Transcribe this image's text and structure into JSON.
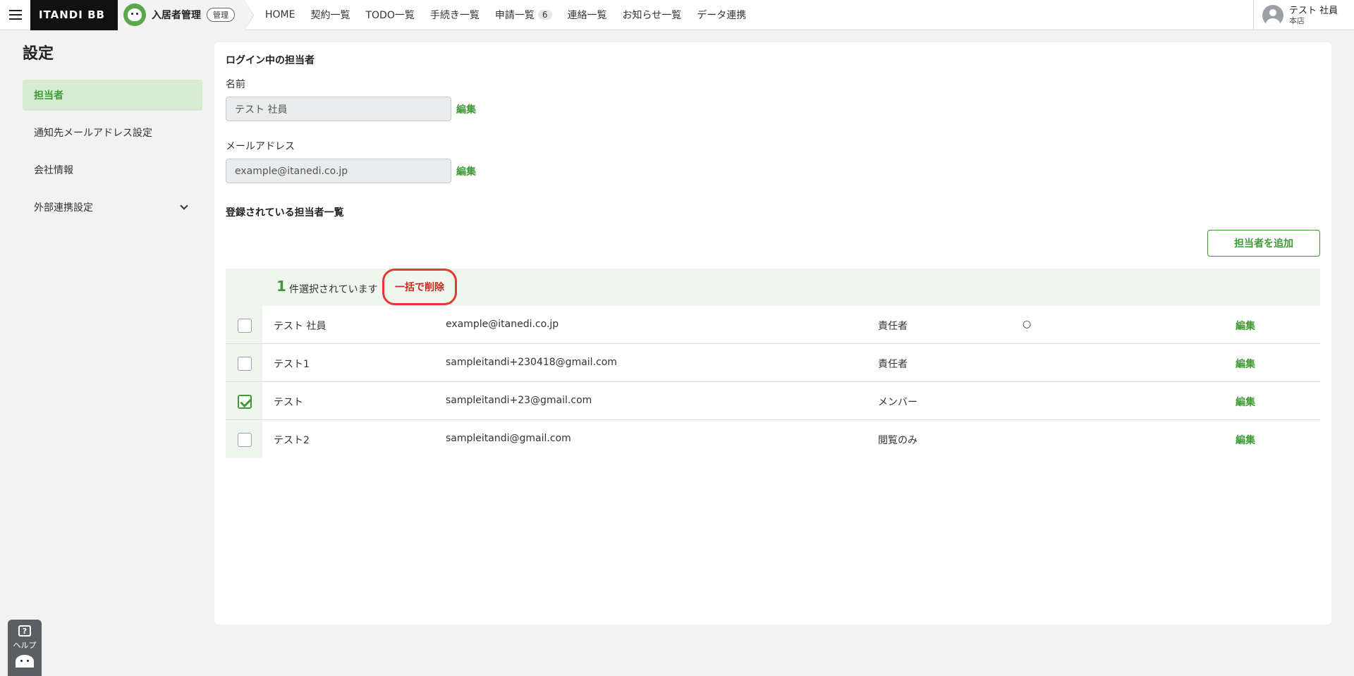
{
  "header": {
    "brand": "ITANDI BB",
    "app_title": "入居者管理",
    "admin_badge": "管理",
    "nav": [
      {
        "label": "HOME"
      },
      {
        "label": "契約一覧"
      },
      {
        "label": "TODO一覧"
      },
      {
        "label": "手続き一覧"
      },
      {
        "label": "申請一覧",
        "count": "6"
      },
      {
        "label": "連絡一覧"
      },
      {
        "label": "お知らせ一覧"
      },
      {
        "label": "データ連携"
      }
    ],
    "user": {
      "name": "テスト 社員",
      "branch": "本店"
    }
  },
  "sidebar": {
    "title": "設定",
    "items": [
      {
        "label": "担当者",
        "active": true
      },
      {
        "label": "通知先メールアドレス設定"
      },
      {
        "label": "会社情報"
      },
      {
        "label": "外部連携設定",
        "expandable": true
      }
    ]
  },
  "main": {
    "login_section_title": "ログイン中の担当者",
    "name_label": "名前",
    "name_value": "テスト 社員",
    "email_label": "メールアドレス",
    "email_value": "example@itanedi.co.jp",
    "edit_label": "編集",
    "list_title": "登録されている担当者一覧",
    "add_button": "担当者を追加",
    "selection": {
      "count": "1",
      "text": "件選択されています",
      "bulk_delete": "一括で削除"
    },
    "rows": [
      {
        "name": "テスト 社員",
        "email": "example@itanedi.co.jp",
        "role": "責任者",
        "mark": "○",
        "checked": false,
        "edit": "編集"
      },
      {
        "name": "テスト1",
        "email": "sampleitandi+230418@gmail.com",
        "role": "責任者",
        "mark": "",
        "checked": false,
        "edit": "編集"
      },
      {
        "name": "テスト",
        "email": "sampleitandi+23@gmail.com",
        "role": "メンバー",
        "mark": "",
        "checked": true,
        "edit": "編集"
      },
      {
        "name": "テスト2",
        "email": "sampleitandi@gmail.com",
        "role": "閲覧のみ",
        "mark": "",
        "checked": false,
        "edit": "編集"
      }
    ]
  },
  "help": {
    "label": "ヘルプ",
    "icon": "?"
  },
  "colors": {
    "accent": "#3f9a36",
    "danger": "#e23a2e",
    "sidebar_active_bg": "#d7ebd3"
  }
}
